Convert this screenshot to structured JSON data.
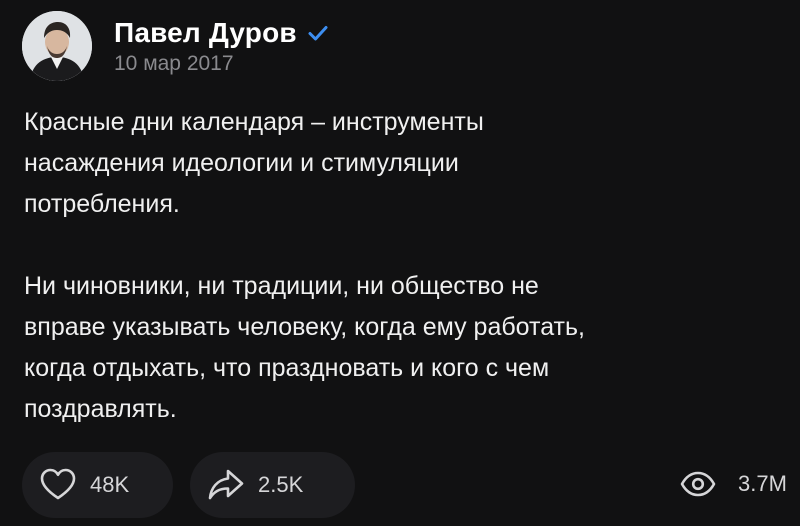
{
  "post": {
    "author_name": "Павел Дуров",
    "date": "10 мар 2017",
    "paragraph_1": "Красные дни календаря – инструменты\nнасаждения идеологии и стимуляции\nпотребления.",
    "paragraph_2": "Ни чиновники, ни традиции, ни общество не\nвправе указывать человеку, когда ему работать,\nкогда отдыхать, что праздновать и кого с чем\nпоздравлять."
  },
  "actions": {
    "likes": "48K",
    "shares": "2.5K",
    "views": "3.7M"
  },
  "icons": {
    "avatar": "avatar-photo",
    "verified": "checkmark-icon",
    "like": "heart-icon",
    "share": "share-arrow-icon",
    "views": "eye-icon"
  },
  "colors": {
    "background": "#111112",
    "verified": "#3d8ef0",
    "muted_text": "#8a8a8e",
    "pill_background": "#1d1d20"
  }
}
